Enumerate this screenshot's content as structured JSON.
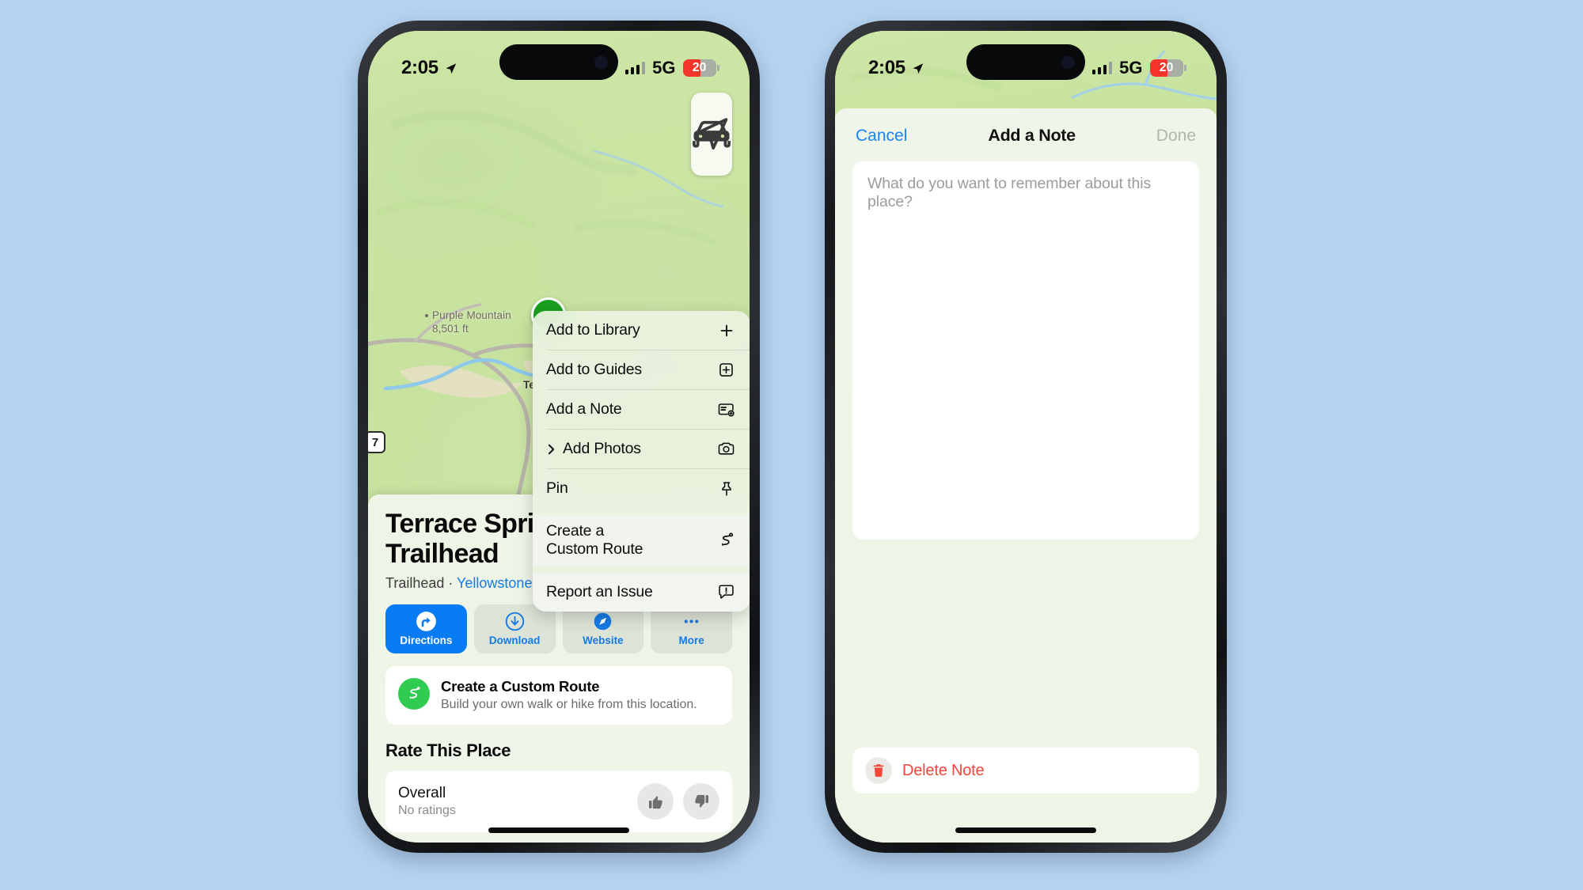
{
  "background_color": "#b6d4f0",
  "accent_blue": "#177ae5",
  "accent_green": "#30cc52",
  "danger_red": "#f2463a",
  "phone_left": {
    "status_bar": {
      "time": "2:05",
      "location_icon": "location-arrow-icon",
      "signal_icon": "cellular-bars-icon",
      "network": "5G",
      "battery_percent": "20"
    },
    "map": {
      "controls": [
        {
          "name": "driving-mode-button",
          "icon": "car-icon"
        },
        {
          "name": "recenter-button",
          "icon": "location-arrow-icon"
        }
      ],
      "labels": [
        {
          "name": "Purple Mountain",
          "elevation": "8,501 ft"
        },
        {
          "name": "Te"
        }
      ],
      "highway_shield": "7",
      "place_pin": "green-place-pin"
    },
    "context_menu": {
      "groups": [
        {
          "items": [
            {
              "label": "Add to Library",
              "icon": "plus-icon",
              "has_chevron": false
            },
            {
              "label": "Add to Guides",
              "icon": "plus-square-icon",
              "has_chevron": false
            },
            {
              "label": "Add a Note",
              "icon": "note-add-icon",
              "has_chevron": false
            },
            {
              "label": "Add Photos",
              "icon": "camera-icon",
              "has_chevron": true
            },
            {
              "label": "Pin",
              "icon": "pin-icon",
              "has_chevron": false
            }
          ]
        },
        {
          "items": [
            {
              "label": "Create a\nCustom Route",
              "icon": "custom-route-icon",
              "has_chevron": false
            }
          ]
        },
        {
          "items": [
            {
              "label": "Report an Issue",
              "icon": "report-issue-icon",
              "has_chevron": false
            }
          ]
        }
      ]
    },
    "place_sheet": {
      "title": "Terrace Spri\nTrailhead",
      "subtitle_prefix": "Trailhead · ",
      "subtitle_link": "Yellowstone",
      "actions": [
        {
          "label": "Directions",
          "icon": "directions-arrow-icon",
          "primary": true
        },
        {
          "label": "Download",
          "icon": "download-circle-icon",
          "primary": false
        },
        {
          "label": "Website",
          "icon": "compass-icon",
          "primary": false
        },
        {
          "label": "More",
          "icon": "ellipsis-icon",
          "primary": false
        }
      ],
      "route_card": {
        "title": "Create a Custom Route",
        "description": "Build your own walk or hike from this location.",
        "icon": "custom-route-icon"
      },
      "rate_section": {
        "heading": "Rate This Place",
        "row_label": "Overall",
        "row_value": "No ratings",
        "buttons": [
          {
            "name": "thumbs-up-button",
            "icon": "thumbs-up-icon"
          },
          {
            "name": "thumbs-down-button",
            "icon": "thumbs-down-icon"
          }
        ]
      }
    }
  },
  "phone_right": {
    "status_bar": {
      "time": "2:05",
      "location_icon": "location-arrow-icon",
      "signal_icon": "cellular-bars-icon",
      "network": "5G",
      "battery_percent": "20"
    },
    "note_sheet": {
      "cancel_label": "Cancel",
      "title": "Add a Note",
      "done_label": "Done",
      "note_value": "",
      "note_placeholder": "What do you want to remember about this place?",
      "delete_label": "Delete Note",
      "delete_icon": "trash-icon"
    }
  }
}
